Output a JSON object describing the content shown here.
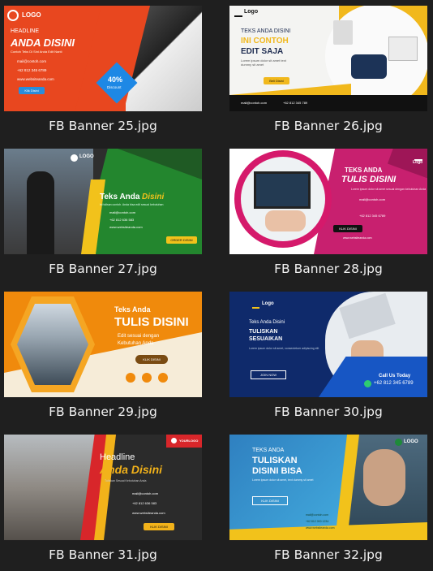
{
  "files": [
    {
      "name": "FB Banner 25.jpg",
      "logo": "LOGO",
      "headline": "HEADLINE",
      "title": "ANDA DISINI",
      "sub": "Contoh Teks Di Sini Anda Edit Nanti",
      "email": "mail@contoh.com",
      "phone": "+62 812 345 6789",
      "web": "www.websiteanda.com",
      "btn": "Klik Disini",
      "badge_pct": "40%",
      "badge_word": "Discount"
    },
    {
      "name": "FB Banner 26.jpg",
      "logo": "Logo",
      "l1": "TEKS ANDA DISINI",
      "l2": "INI CONTOH",
      "l3": "EDIT SAJA",
      "sub": "Lorem ipsum dolor sit amet text dummy sit amet",
      "btn": "Beli Disini",
      "email": "mail@contoh.com",
      "phone": "+62 812 345 789"
    },
    {
      "name": "FB Banner 27.jpg",
      "logo": "LOGO",
      "t1": "Teks Anda",
      "t2": "Disini",
      "sub": "Isi tulisan contoh. Anda bisa edit sesuai kebutuhan",
      "email": "mail@contoh.com",
      "phone": "+62 812 636 583",
      "web": "www.websiteanda.com",
      "btn": "ORDER DISINI"
    },
    {
      "name": "FB Banner 28.jpg",
      "logo": "Logo",
      "t1": "TEKS ANDA",
      "t2": "TULIS DISINI",
      "sub": "Lorem ipsum dolor sit amet sesuai dengan kebutuhan Anda",
      "email": "mail@contoh.com",
      "phone": "+62 812 345 6789",
      "btn": "KLIK DISINI",
      "web": "www.websiteanda.com"
    },
    {
      "name": "FB Banner 29.jpg",
      "t1": "Teks Anda",
      "t2": "TULIS DISINI",
      "sub1": "Edit sesuai dengan",
      "sub2": "Kebutuhan Anda",
      "btn": "KLIK DISINI"
    },
    {
      "name": "FB Banner 30.jpg",
      "logo": "Logo",
      "t1": "Teks Anda Disini",
      "t2": "TULISKAN",
      "t3": "SESUAIKAN",
      "sub": "Lorem ipsum dolor sit amet, consectetuer adipiscing elit",
      "btn": "JOIN NOW",
      "call": "Call Us Today",
      "phone": "+62 812 345 6789"
    },
    {
      "name": "FB Banner 31.jpg",
      "logo": "YOURLOGO",
      "t1": "Headline",
      "t2": "Anda Disini",
      "sub": "Tuliskan Sesuai Kebutuhan Anda",
      "email": "mail@contoh.com",
      "phone": "+62 812 636 583",
      "web": "www.websiteanda.com",
      "btn": "KLIK DISINI"
    },
    {
      "name": "FB Banner 32.jpg",
      "logo": "LOGO",
      "t1": "TEKS ANDA",
      "t2": "TULISKAN",
      "t3": "DISINI BISA",
      "sub": "Lorem ipsum dolor sit amet, text dummy sit amet",
      "btn": "KLIK DISINI",
      "email": "mail@contoh.com",
      "phone": "+62 812 000 1234",
      "web": "www.websiteanda.com"
    }
  ],
  "colors": {
    "background": "#1f1f1f",
    "caption": "#f2f2f2"
  }
}
